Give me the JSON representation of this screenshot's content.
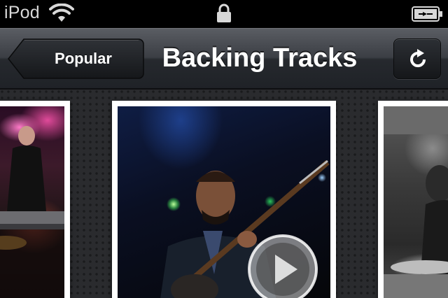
{
  "status_bar": {
    "device_name": "iPod",
    "icons": [
      "wifi-icon",
      "lock-icon",
      "battery-charging-icon"
    ]
  },
  "nav_bar": {
    "back_label": "Popular",
    "title": "Backing Tracks",
    "refresh_icon": "refresh-icon"
  },
  "carousel": {
    "cards": [
      {
        "name": "performer-keyboard-photo",
        "description_visible": false
      },
      {
        "name": "performer-guitar-photo",
        "description_visible": false
      },
      {
        "name": "performer-drums-photo",
        "description_visible": false
      }
    ],
    "play_icon": "play-icon"
  },
  "colors": {
    "status_bar_bg": "#000000",
    "nav_bar_top": "#5a5d63",
    "nav_bar_bottom": "#1f2227",
    "content_bg": "#2a2b2e",
    "card_border": "#ffffff"
  }
}
